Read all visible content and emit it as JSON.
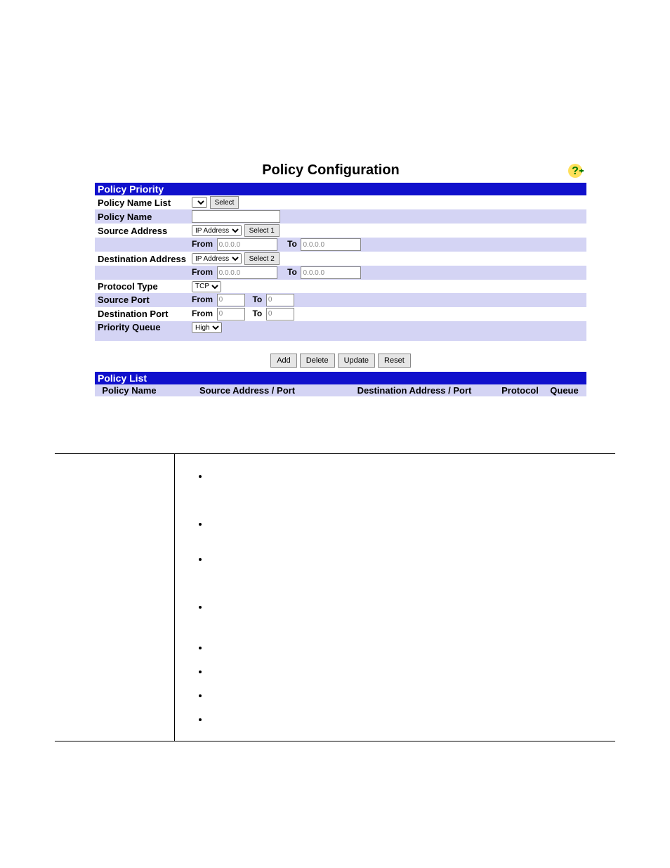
{
  "panel": {
    "title": "Policy Configuration",
    "section_priority": "Policy Priority",
    "section_list": "Policy List",
    "labels": {
      "policy_name_list": "Policy Name List",
      "policy_name": "Policy Name",
      "source_address": "Source Address",
      "destination_address": "Destination Address",
      "protocol_type": "Protocol Type",
      "source_port": "Source Port",
      "destination_port": "Destination Port",
      "priority_queue": "Priority Queue",
      "from": "From",
      "to": "To"
    },
    "inputs": {
      "policy_name_value": "",
      "source_addr_type": "IP Address",
      "dest_addr_type": "IP Address",
      "protocol": "TCP",
      "priority": "High",
      "src_from_ip": "0.0.0.0",
      "src_to_ip": "0.0.0.0",
      "dst_from_ip": "0.0.0.0",
      "dst_to_ip": "0.0.0.0",
      "src_port_from": "0",
      "src_port_to": "0",
      "dst_port_from": "0",
      "dst_port_to": "0"
    },
    "buttons": {
      "select": "Select",
      "select1": "Select 1",
      "select2": "Select 2",
      "add": "Add",
      "delete": "Delete",
      "update": "Update",
      "reset": "Reset"
    },
    "list_headers": {
      "name": "Policy Name",
      "src": "Source Address / Port",
      "dst": "Destination Address / Port",
      "protocol": "Protocol",
      "queue": "Queue"
    }
  },
  "description": {
    "left": "",
    "bullets": [
      "",
      "",
      "",
      "",
      "",
      "",
      "",
      ""
    ]
  }
}
